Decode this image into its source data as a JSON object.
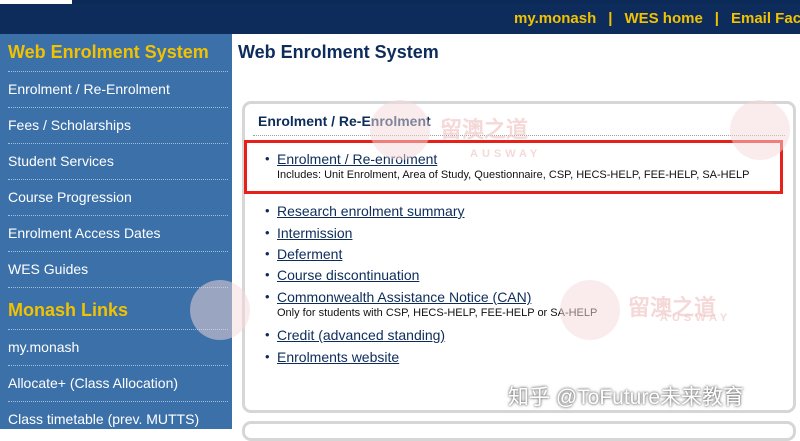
{
  "top_nav": {
    "links": [
      {
        "label": "my.monash"
      },
      {
        "label": "WES home"
      },
      {
        "label": "Email Fac"
      }
    ],
    "separator": "|"
  },
  "sidebar": {
    "title": "Web Enrolment System",
    "items": [
      {
        "label": "Enrolment / Re-Enrolment"
      },
      {
        "label": "Fees / Scholarships"
      },
      {
        "label": "Student Services"
      },
      {
        "label": "Course Progression"
      },
      {
        "label": "Enrolment Access Dates"
      },
      {
        "label": "WES Guides"
      }
    ],
    "section2_title": "Monash Links",
    "links": [
      {
        "label": "my.monash"
      },
      {
        "label": "Allocate+ (Class Allocation)"
      },
      {
        "label": "Class timetable (prev. MUTTS)"
      }
    ]
  },
  "main": {
    "title": "Web Enrolment System",
    "panel": {
      "title": "Enrolment / Re-Enrolment",
      "items": [
        {
          "label": "Enrolment / Re-enrolment",
          "desc": "Includes: Unit Enrolment, Area of Study, Questionnaire, CSP, HECS-HELP, FEE-HELP, SA-HELP"
        },
        {
          "label": "Research enrolment summary"
        },
        {
          "label": "Intermission"
        },
        {
          "label": "Deferment"
        },
        {
          "label": "Course discontinuation"
        },
        {
          "label": "Commonwealth Assistance Notice (CAN)",
          "desc": "Only for students with CSP, HECS-HELP, FEE-HELP or SA-HELP"
        },
        {
          "label": "Credit (advanced standing)"
        },
        {
          "label": "Enrolments website"
        }
      ]
    }
  },
  "watermarks": {
    "brand_cn": "留澳之道",
    "brand_en": "AUSWAY"
  },
  "credit": "知乎 @ToFuture未来教育",
  "colors": {
    "nav_bg": "#0d2c5b",
    "sidebar_bg": "#3c70a8",
    "accent_yellow": "#f2c200",
    "highlight_red": "#e8201a"
  }
}
